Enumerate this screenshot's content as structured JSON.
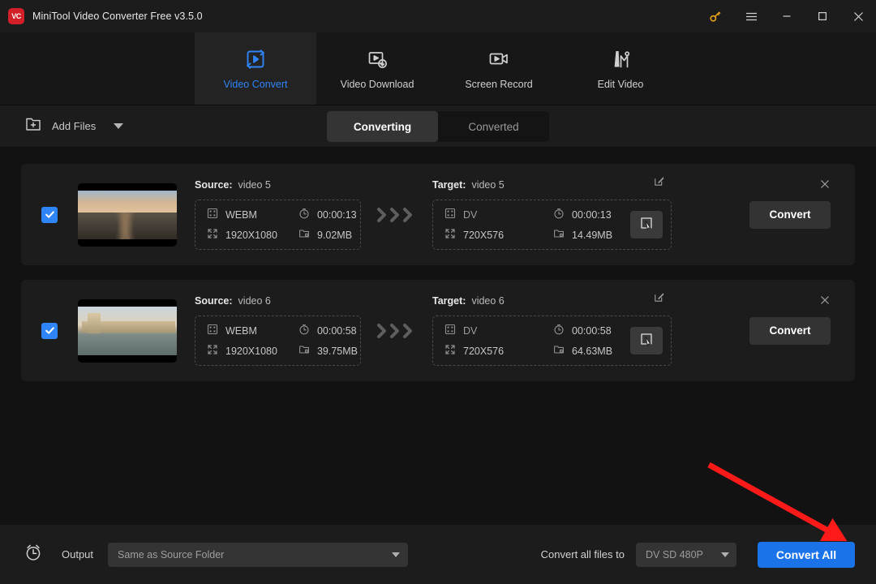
{
  "window": {
    "title": "MiniTool Video Converter Free v3.5.0",
    "logo_text": "VC",
    "controls": {
      "key": "key-icon",
      "menu": "hamburger-menu-icon",
      "minimize": "minimize-icon",
      "maximize": "maximize-icon",
      "close": "close-icon"
    }
  },
  "nav": {
    "items": [
      {
        "label": "Video Convert",
        "icon": "video-convert-icon",
        "active": true
      },
      {
        "label": "Video Download",
        "icon": "video-download-icon",
        "active": false
      },
      {
        "label": "Screen Record",
        "icon": "screen-record-icon",
        "active": false
      },
      {
        "label": "Edit Video",
        "icon": "edit-video-icon",
        "active": false
      }
    ]
  },
  "toolbar": {
    "add_files_label": "Add Files",
    "add_files_icon": "folder-plus-icon",
    "tabs": [
      {
        "label": "Converting",
        "active": true
      },
      {
        "label": "Converted",
        "active": false
      }
    ]
  },
  "files": [
    {
      "checked": true,
      "thumbnail": "pier-sunset-thumbnail",
      "source": {
        "title_label": "Source:",
        "name": "video 5",
        "format": "WEBM",
        "duration": "00:00:13",
        "resolution": "1920X1080",
        "size": "9.02MB"
      },
      "target": {
        "title_label": "Target:",
        "name": "video 5",
        "format": "DV",
        "duration": "00:00:13",
        "resolution": "720X576",
        "size": "14.49MB"
      },
      "convert_label": "Convert"
    },
    {
      "checked": true,
      "thumbnail": "westminster-thames-thumbnail",
      "source": {
        "title_label": "Source:",
        "name": "video 6",
        "format": "WEBM",
        "duration": "00:00:58",
        "resolution": "1920X1080",
        "size": "39.75MB"
      },
      "target": {
        "title_label": "Target:",
        "name": "video 6",
        "format": "DV",
        "duration": "00:00:58",
        "resolution": "720X576",
        "size": "64.63MB"
      },
      "convert_label": "Convert"
    }
  ],
  "bottom": {
    "timer_icon": "alarm-clock-icon",
    "output_label": "Output",
    "output_value": "Same as Source Folder",
    "convert_all_files_label": "Convert all files to",
    "preset_value": "DV SD 480P",
    "convert_all_label": "Convert All"
  },
  "colors": {
    "accent_blue": "#2f84f7",
    "button_blue": "#1a73e8",
    "annotation_red": "#ff1a1a",
    "logo_red": "#d32028",
    "key_orange": "#e8a317"
  }
}
